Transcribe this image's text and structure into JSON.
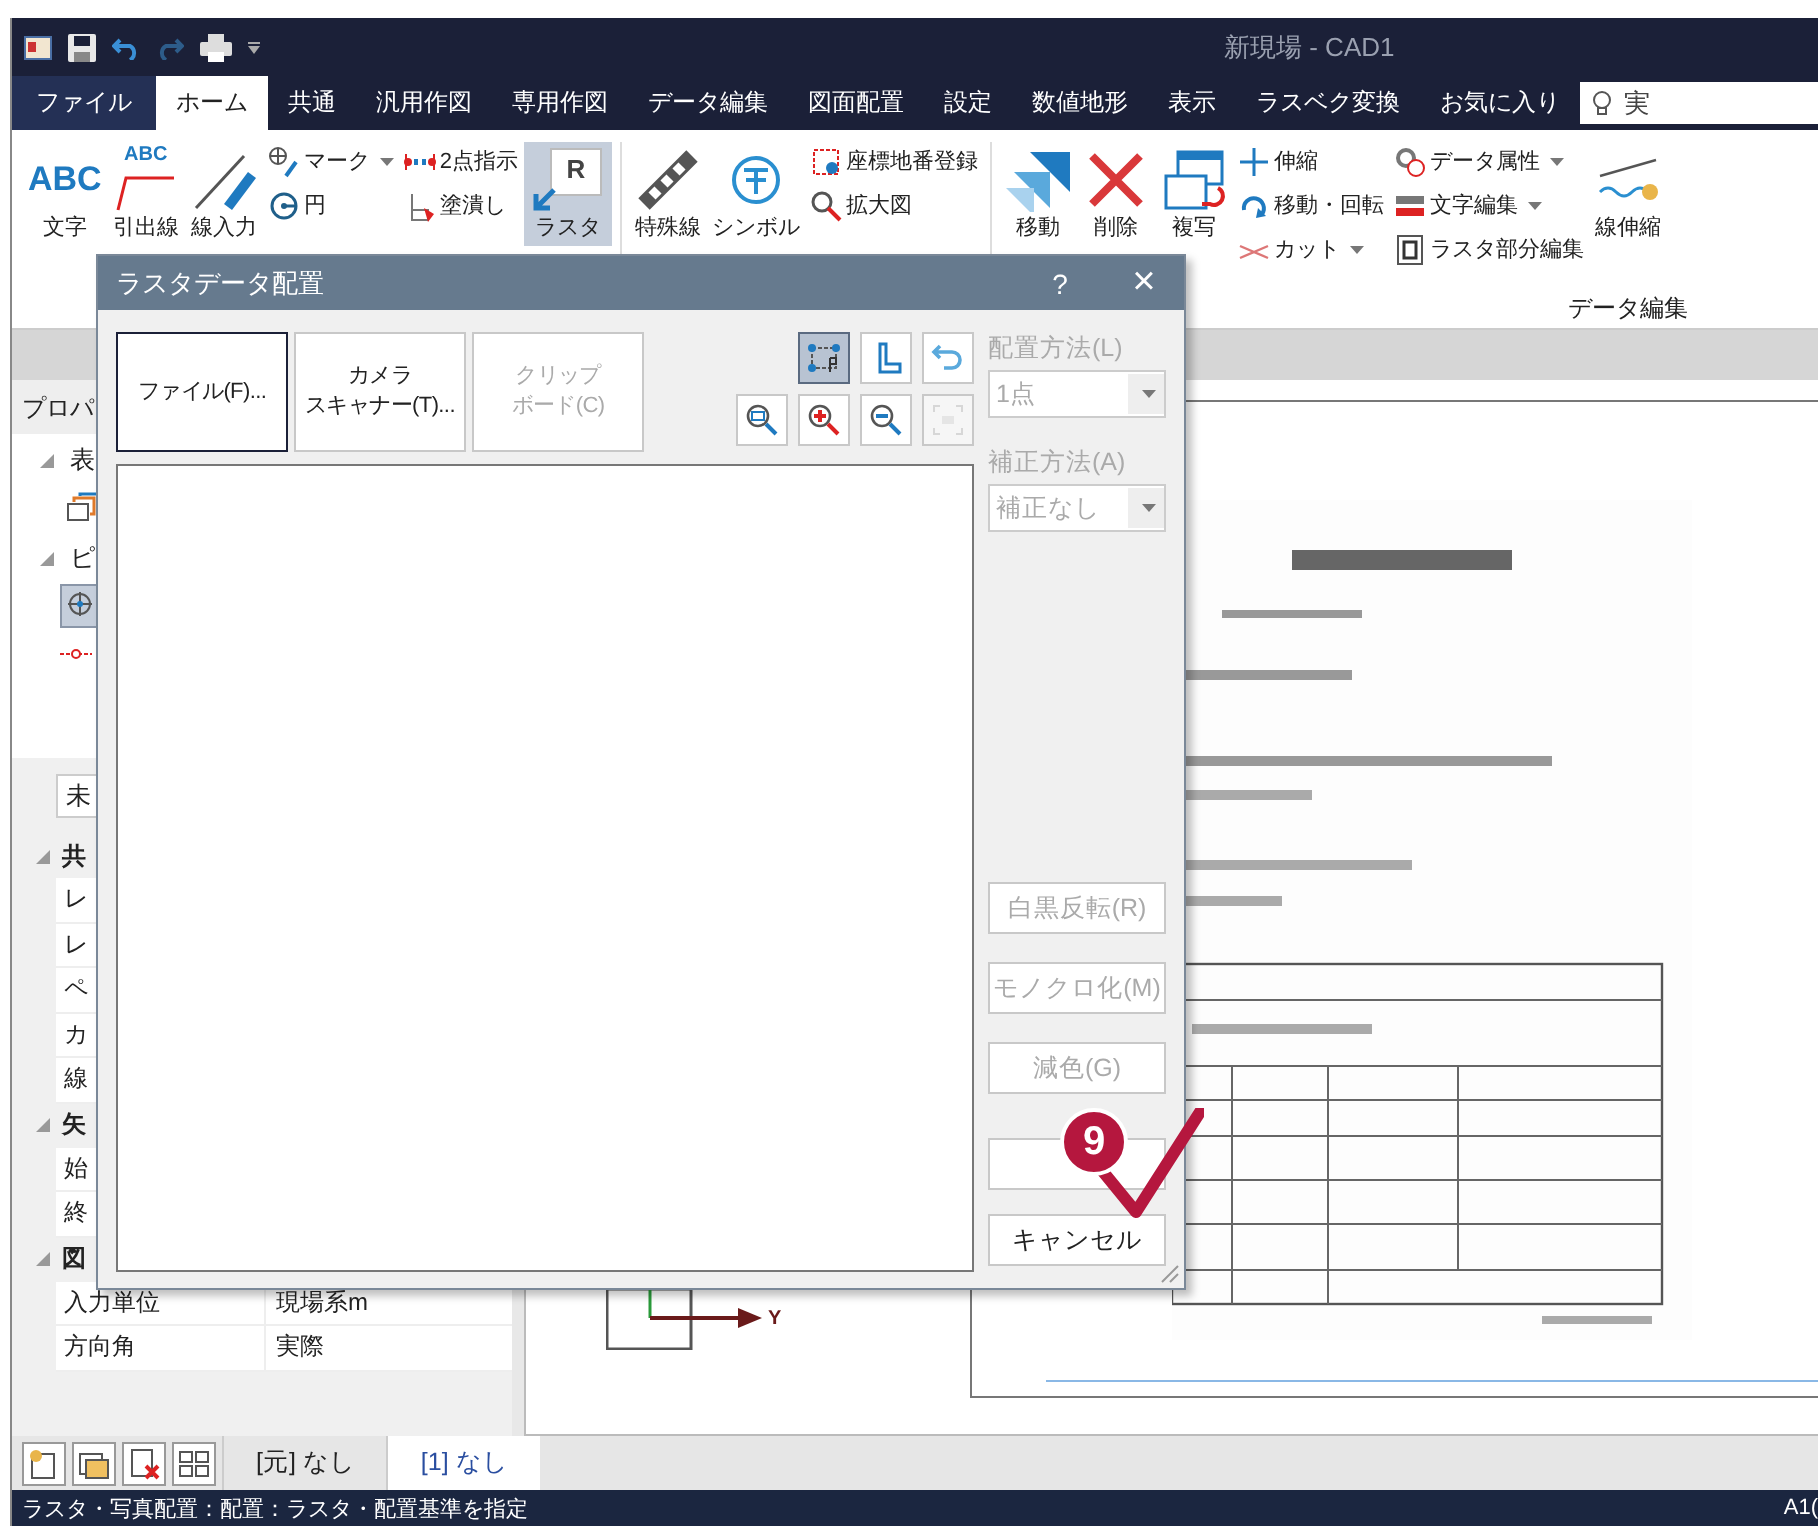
{
  "window": {
    "title": "新現場 - CAD1"
  },
  "menu_tabs": [
    {
      "label": "ファイル",
      "kind": "backstage",
      "selected": false
    },
    {
      "label": "ホーム",
      "kind": "tab",
      "selected": true
    },
    {
      "label": "共通",
      "kind": "tab",
      "selected": false
    },
    {
      "label": "汎用作図",
      "kind": "tab",
      "selected": false
    },
    {
      "label": "専用作図",
      "kind": "tab",
      "selected": false
    },
    {
      "label": "データ編集",
      "kind": "tab",
      "selected": false
    },
    {
      "label": "図面配置",
      "kind": "tab",
      "selected": false
    },
    {
      "label": "設定",
      "kind": "tab",
      "selected": false
    },
    {
      "label": "数値地形",
      "kind": "tab",
      "selected": false
    },
    {
      "label": "表示",
      "kind": "tab",
      "selected": false
    },
    {
      "label": "ラスベク変換",
      "kind": "tab",
      "selected": false
    },
    {
      "label": "お気に入り",
      "kind": "tab",
      "selected": false
    }
  ],
  "tell_me": {
    "placeholder": "実"
  },
  "ribbon": {
    "columns": [
      {
        "kind": "large",
        "glyph": "ABC",
        "label": "文字",
        "selected": false
      },
      {
        "kind": "large",
        "glyph": "ABC",
        "label": "引出線",
        "selected": false
      },
      {
        "kind": "large",
        "label": "線入力",
        "selected": false
      },
      {
        "kind": "small",
        "items": [
          {
            "label": "マーク",
            "dropdown": true
          },
          {
            "label": "円",
            "dropdown": false
          }
        ]
      },
      {
        "kind": "small",
        "items": [
          {
            "label": "2点指示",
            "dropdown": false
          },
          {
            "label": "塗潰し",
            "dropdown": false
          }
        ]
      },
      {
        "kind": "large",
        "glyph": "R",
        "label": "ラスタ",
        "selected": true
      },
      {
        "kind": "separator"
      },
      {
        "kind": "large",
        "label": "特殊線",
        "selected": false
      },
      {
        "kind": "large",
        "label": "シンボル",
        "selected": false
      },
      {
        "kind": "small",
        "items": [
          {
            "label": "座標地番登録",
            "dropdown": false
          },
          {
            "label": "拡大図",
            "dropdown": false
          }
        ]
      },
      {
        "kind": "separator"
      },
      {
        "kind": "large",
        "label": "移動",
        "selected": false
      },
      {
        "kind": "large",
        "label": "削除",
        "selected": false
      },
      {
        "kind": "large",
        "label": "複写",
        "selected": false
      },
      {
        "kind": "small",
        "items": [
          {
            "label": "伸縮",
            "dropdown": false
          },
          {
            "label": "移動・回転",
            "dropdown": false
          },
          {
            "label": "カット",
            "dropdown": true
          }
        ]
      },
      {
        "kind": "small",
        "items": [
          {
            "label": "データ属性",
            "dropdown": true
          },
          {
            "label": "文字編集",
            "dropdown": true
          },
          {
            "label": "ラスタ部分編集",
            "dropdown": false
          }
        ]
      },
      {
        "kind": "large",
        "label": "線伸縮",
        "selected": false
      }
    ],
    "group_label": "データ編集"
  },
  "properties_panel": {
    "title": "プロパ",
    "sections": [
      {
        "label": "表",
        "expanded": true
      },
      {
        "label": "ピ",
        "expanded": true
      }
    ],
    "filter": "未",
    "groups": [
      {
        "label": "共",
        "expanded": true,
        "rows": [
          {
            "name": "レ"
          },
          {
            "name": "レ"
          },
          {
            "name": "ペ"
          },
          {
            "name": "カ"
          },
          {
            "name": "線"
          }
        ]
      },
      {
        "label": "矢",
        "expanded": true,
        "rows": [
          {
            "name": "始"
          },
          {
            "name": "終"
          }
        ]
      },
      {
        "label": "図",
        "expanded": true,
        "rows": [
          {
            "name": "入力単位",
            "value": "現場系m"
          },
          {
            "name": "方向角",
            "value": "実際"
          }
        ]
      }
    ]
  },
  "canvas": {
    "axis_label": "Y"
  },
  "bottom_tabs": [
    {
      "label": "[元] なし",
      "selected": false
    },
    {
      "label": "[1] なし",
      "selected": true
    }
  ],
  "status_bar": {
    "message": "ラスタ・写真配置：配置：ラスタ・配置基準を指定",
    "position": "A1("
  },
  "dialog": {
    "title": "ラスタデータ配置",
    "help": "?",
    "close": "×",
    "sources": [
      {
        "lines": [
          "ファイル(F)..."
        ],
        "selected": true,
        "disabled": false
      },
      {
        "lines": [
          "カメラ",
          "スキャナー(T)..."
        ],
        "selected": false,
        "disabled": false
      },
      {
        "lines": [
          "クリップ",
          "ボード(C)"
        ],
        "selected": false,
        "disabled": true
      }
    ],
    "tools": [
      {
        "selected": true,
        "disabled": false
      },
      {
        "selected": false,
        "disabled": false
      },
      {
        "selected": false,
        "disabled": false
      },
      {
        "selected": false,
        "disabled": false
      },
      {
        "selected": false,
        "disabled": false
      },
      {
        "selected": false,
        "disabled": false
      },
      {
        "selected": false,
        "disabled": true
      }
    ],
    "placement": {
      "label": "配置方法(L)",
      "value": "1点",
      "disabled": true
    },
    "correction": {
      "label": "補正方法(A)",
      "value": "補正なし",
      "disabled": true
    },
    "actions": [
      {
        "label": "白黒反転(R)",
        "disabled": true
      },
      {
        "label": "モノクロ化(M)",
        "disabled": true
      },
      {
        "label": "減色(G)",
        "disabled": true
      }
    ],
    "buttons": [
      {
        "kind": "covered"
      },
      {
        "kind": "text",
        "label": "キャンセル"
      }
    ]
  },
  "callout": {
    "number": "9"
  }
}
